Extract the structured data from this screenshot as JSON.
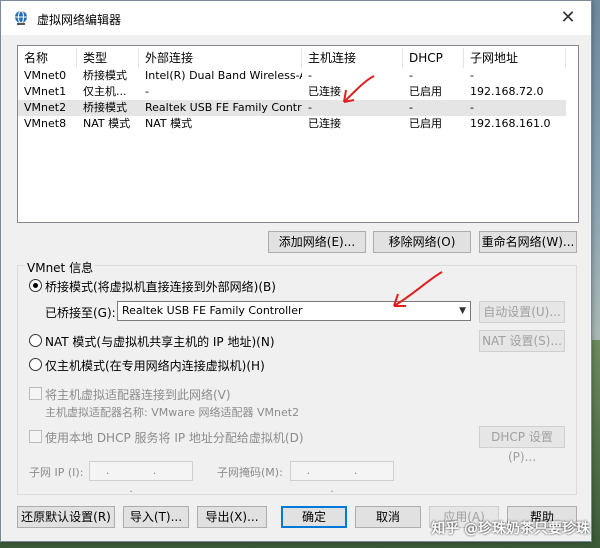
{
  "window": {
    "title": "虚拟网络编辑器",
    "close_glyph": "✕"
  },
  "table": {
    "headers": [
      "名称",
      "类型",
      "外部连接",
      "主机连接",
      "DHCP",
      "子网地址"
    ],
    "rows": [
      [
        "VMnet0",
        "桥接模式",
        "Intel(R) Dual Band Wireless-A...",
        "-",
        "-",
        "-"
      ],
      [
        "VMnet1",
        "仅主机...",
        "-",
        "已连接",
        "已启用",
        "192.168.72.0"
      ],
      [
        "VMnet2",
        "桥接模式",
        "Realtek USB FE Family Controller",
        "-",
        "-",
        "-"
      ],
      [
        "VMnet8",
        "NAT 模式",
        "NAT 模式",
        "已连接",
        "已启用",
        "192.168.161.0"
      ]
    ]
  },
  "list_buttons": {
    "add": "添加网络(E)...",
    "remove": "移除网络(O)",
    "rename": "重命名网络(W)..."
  },
  "vmnet_info": {
    "group_label": "VMnet 信息",
    "bridge_label": "桥接模式(将虚拟机直接连接到外部网络)(B)",
    "bridged_to_label": "已桥接至(G):",
    "bridged_to_value": "Realtek USB FE Family Controller",
    "auto_settings": "自动设置(U)...",
    "nat_label": "NAT 模式(与虚拟机共享主机的 IP 地址)(N)",
    "nat_settings": "NAT 设置(S)...",
    "host_only_label": "仅主机模式(在专用网络内连接虚拟机)(H)",
    "connect_adapter_label": "将主机虚拟适配器连接到此网络(V)",
    "adapter_name_label": "主机虚拟适配器名称: VMware 网络适配器 VMnet2",
    "dhcp_label": "使用本地 DHCP 服务将 IP 地址分配给虚拟机(D)",
    "dhcp_settings": "DHCP 设置(P)...",
    "subnet_ip_label": "子网 IP (I):",
    "subnet_ip_value": ". . .",
    "subnet_mask_label": "子网掩码(M):",
    "subnet_mask_value": ". . ."
  },
  "footer": {
    "restore": "还原默认设置(R)",
    "import": "导入(T)...",
    "export": "导出(X)...",
    "ok": "确定",
    "cancel": "取消",
    "apply": "应用(A)",
    "help": "帮助"
  },
  "watermark": "知乎 @珍珠奶茶只要珍珠",
  "colors": {
    "accent": "#0078d7",
    "annotation_arrow": "#e02020"
  }
}
